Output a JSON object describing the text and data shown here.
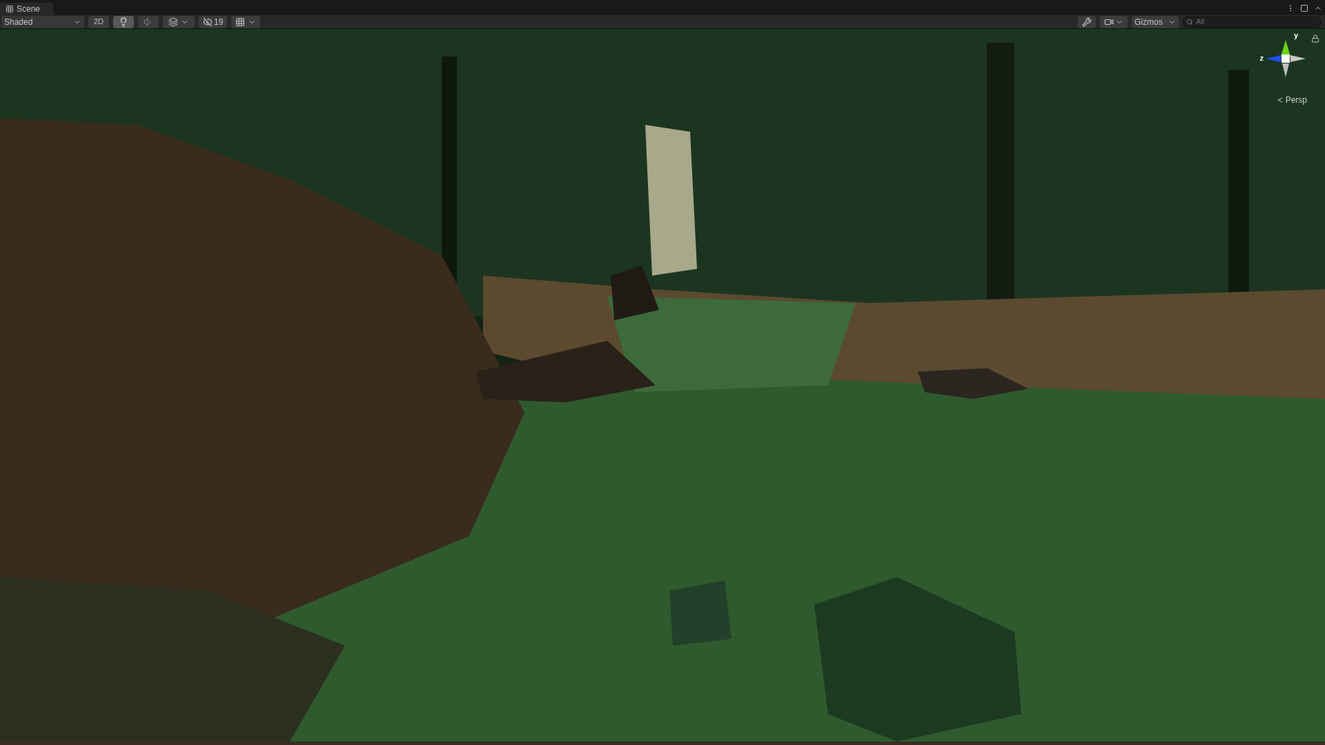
{
  "tab": {
    "title": "Scene"
  },
  "toolbar": {
    "draw_mode": "Shaded",
    "toggles": [
      {
        "kind": "dimension",
        "label": "2D",
        "selected": false
      },
      {
        "kind": "lighting",
        "selected": true
      },
      {
        "kind": "audio",
        "selected": false
      },
      {
        "kind": "effects",
        "selected": false
      }
    ],
    "hidden_count": "19",
    "gizmos": "Gizmos",
    "search": {
      "placeholder": "All"
    }
  },
  "viewport": {
    "axis_labels": {
      "up": "y",
      "side": "z"
    },
    "projection": "Persp"
  }
}
